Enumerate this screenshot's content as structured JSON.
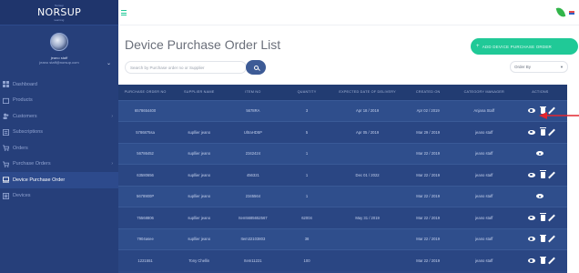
{
  "brand": {
    "top": "Norsup",
    "name": "NORSUP",
    "sub": "learning"
  },
  "profile": {
    "name": "jeano staff",
    "email": "jeano staff@norsup.com"
  },
  "sidebar": {
    "items": [
      {
        "label": "Dashboard",
        "icon": "dashboard-icon",
        "chevron": ""
      },
      {
        "label": "Products",
        "icon": "box-icon",
        "chevron": ""
      },
      {
        "label": "Customers",
        "icon": "users-icon",
        "chevron": "›"
      },
      {
        "label": "Subscriptions",
        "icon": "subscription-icon",
        "chevron": ""
      },
      {
        "label": "Orders",
        "icon": "cart-icon",
        "chevron": ""
      },
      {
        "label": "Purchase Orders",
        "icon": "purchase-icon",
        "chevron": "›"
      },
      {
        "label": "Device Purchase Order",
        "icon": "device-icon",
        "chevron": ""
      },
      {
        "label": "Devices",
        "icon": "devices-icon",
        "chevron": ""
      }
    ]
  },
  "page": {
    "title": "Device Purchase Order List",
    "add_button": "ADD DEVICE PURCHASE ORDER",
    "search_placeholder": "Search by Purchase order no or Supplier",
    "order_by": "Order By"
  },
  "table": {
    "headers": [
      "PURCHASE ORDER NO",
      "SUPPLIER NAME",
      "ITEM NO",
      "QUANTITY",
      "EXPECTED DATE OF DELIVERY",
      "CREATED ON",
      "CATEGORY MANAGER",
      "ACTIONS"
    ],
    "rows": [
      {
        "po": "6578654400",
        "supplier": "",
        "item": "5678RA",
        "qty": "3",
        "delivery": "Apr 18 / 2019",
        "created": "Apr 02 / 2019",
        "manager": "Anjana Staff",
        "actions": [
          "eye",
          "trash",
          "pencil"
        ]
      },
      {
        "po": "5786875sa",
        "supplier": "supllier jeano",
        "item": "UltraHD5P",
        "qty": "5",
        "delivery": "Apr 05 / 2019",
        "created": "Mar 29 / 2019",
        "manager": "jeano staff",
        "actions": [
          "eye",
          "trash",
          "pencil"
        ]
      },
      {
        "po": "56786452",
        "supplier": "supllier jeano",
        "item": "2342424",
        "qty": "1",
        "delivery": "",
        "created": "Mar 22 / 2019",
        "manager": "jeano staff",
        "actions": [
          "eye"
        ]
      },
      {
        "po": "63580656",
        "supplier": "supllier jeano",
        "item": "456321",
        "qty": "1",
        "delivery": "Dec 01 / 2022",
        "created": "Mar 22 / 2019",
        "manager": "jeano staff",
        "actions": [
          "eye",
          "trash",
          "pencil"
        ]
      },
      {
        "po": "5678900P",
        "supplier": "supllier jeano",
        "item": "2345564",
        "qty": "1",
        "delivery": "",
        "created": "Mar 22 / 2019",
        "manager": "jeano staff",
        "actions": [
          "eye"
        ]
      },
      {
        "po": "75568806",
        "supplier": "supllier jeano",
        "item": "Item5685652567",
        "qty": "62004",
        "delivery": "May 31 / 2019",
        "created": "Mar 22 / 2019",
        "manager": "jeano staff",
        "actions": [
          "eye",
          "trash",
          "pencil"
        ]
      },
      {
        "po": "7904asee",
        "supplier": "supllier jeano",
        "item": "Item32103803",
        "qty": "38",
        "delivery": "",
        "created": "Mar 22 / 2019",
        "manager": "jeano staff",
        "actions": [
          "eye",
          "trash",
          "pencil"
        ]
      },
      {
        "po": "1221551",
        "supplier": "Tony Chellin",
        "item": "Item11221",
        "qty": "100",
        "delivery": "",
        "created": "Mar 22 / 2019",
        "manager": "jeano staff",
        "actions": [
          "eye",
          "trash",
          "pencil"
        ]
      }
    ]
  },
  "colors": {
    "sidebar": "#263f7a",
    "accent": "#20c997",
    "table": "#2c4a86",
    "arrow": "#e3262f"
  }
}
